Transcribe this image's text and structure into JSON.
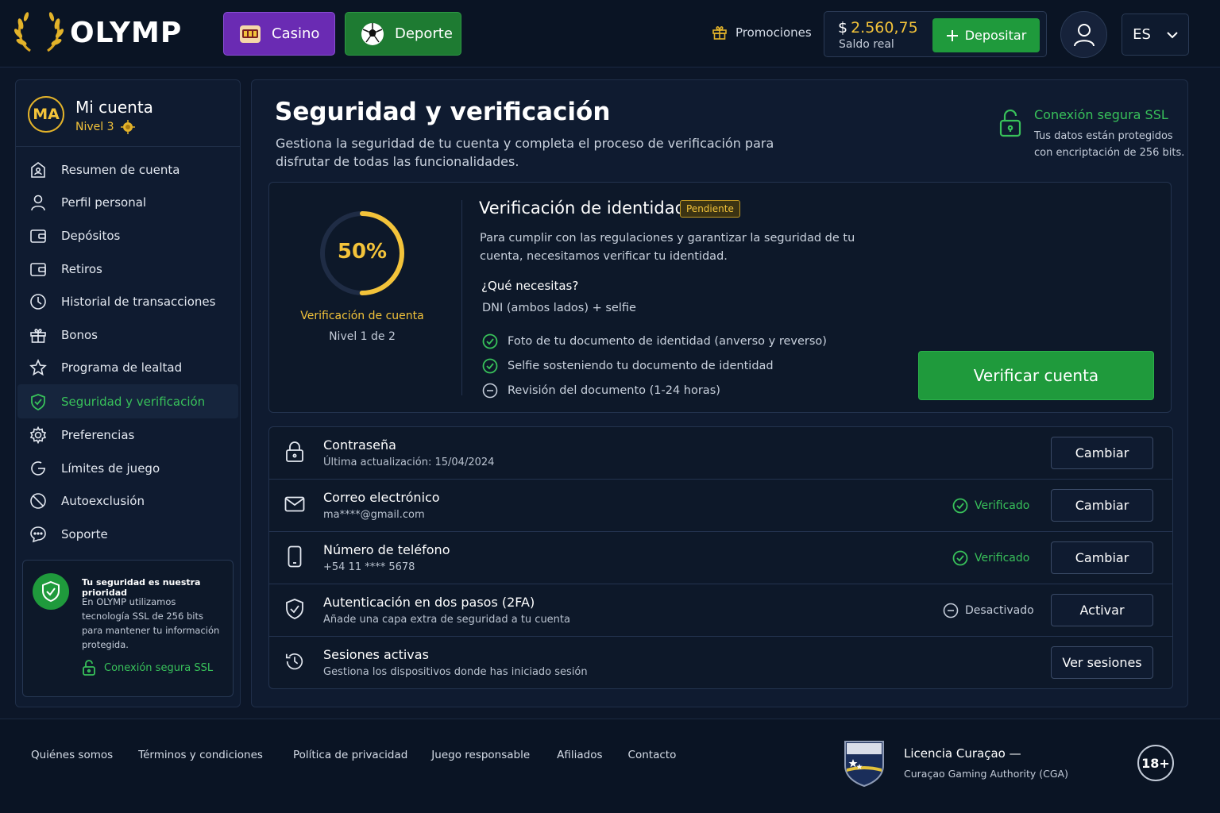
{
  "header": {
    "logo_text": "OLYMP",
    "nav": {
      "casino": "Casino",
      "deporte": "Deporte"
    },
    "promotions": "Promociones",
    "balance": {
      "currency": "$",
      "amount": "2.560,75",
      "label": "Saldo real"
    },
    "deposit": "Depositar",
    "language": "ES"
  },
  "sidebar": {
    "avatar_initials": "MA",
    "title": "Mi cuenta",
    "level": "Nivel 3",
    "items": [
      {
        "label": "Resumen de cuenta",
        "icon": "account-summary-icon"
      },
      {
        "label": "Perfil personal",
        "icon": "user-icon"
      },
      {
        "label": "Depósitos",
        "icon": "wallet-icon"
      },
      {
        "label": "Retiros",
        "icon": "wallet-icon"
      },
      {
        "label": "Historial de transacciones",
        "icon": "clock-icon"
      },
      {
        "label": "Bonos",
        "icon": "gift-icon"
      },
      {
        "label": "Programa de lealtad",
        "icon": "star-icon"
      },
      {
        "label": "Seguridad y verificación",
        "icon": "shield-check-icon",
        "active": true
      },
      {
        "label": "Preferencias",
        "icon": "gear-icon"
      },
      {
        "label": "Límites de juego",
        "icon": "limit-icon"
      },
      {
        "label": "Autoexclusión",
        "icon": "block-icon"
      },
      {
        "label": "Soporte",
        "icon": "chat-icon"
      }
    ],
    "security_card": {
      "title": "Tu seguridad es nuestra prioridad",
      "text": "En OLYMP utilizamos tecnología SSL de 256 bits para mantener tu información protegida.",
      "ssl": "Conexión segura SSL"
    }
  },
  "main": {
    "title": "Seguridad y verificación",
    "subtitle": "Gestiona la seguridad de tu cuenta y completa el proceso de verificación para disfrutar de todas las funcionalidades.",
    "ssl": {
      "title": "Conexión segura SSL",
      "text": "Tus datos están protegidos con encriptación de 256 bits."
    },
    "verification": {
      "progress_value": 0.5,
      "percent_label": "50%",
      "label": "Verificación de cuenta",
      "level": "Nivel 1 de 2",
      "title": "Verificación de identidad",
      "badge": "Pendiente",
      "description": "Para cumplir con las regulaciones y garantizar la seguridad de tu cuenta, necesitamos verificar tu identidad.",
      "question": "¿Qué necesitas?",
      "requirement": "DNI (ambos lados) + selfie",
      "checklist": [
        {
          "text": "Foto de tu documento de identidad (anverso y reverso)",
          "done": true
        },
        {
          "text": "Selfie sosteniendo tu documento de identidad",
          "done": true
        },
        {
          "text": "Revisión del documento (1-24 horas)",
          "done": false
        }
      ],
      "button": "Verificar cuenta"
    },
    "settings": [
      {
        "title": "Contraseña",
        "sub": "Última actualización: 15/04/2024",
        "status": "",
        "button": "Cambiar"
      },
      {
        "title": "Correo electrónico",
        "sub": "ma****@gmail.com",
        "status": "Verificado",
        "button": "Cambiar"
      },
      {
        "title": "Número de teléfono",
        "sub": "+54 11 **** 5678",
        "status": "Verificado",
        "button": "Cambiar"
      },
      {
        "title": "Autenticación en dos pasos (2FA)",
        "sub": "Añade una capa extra de seguridad a tu cuenta",
        "status": "Desactivado",
        "button": "Activar"
      },
      {
        "title": "Sesiones activas",
        "sub": "Gestiona los dispositivos donde has iniciado sesión",
        "status": "",
        "button": "Ver sesiones"
      }
    ]
  },
  "footer": {
    "links": [
      "Quiénes somos",
      "Términos y condiciones",
      "Política de privacidad",
      "Juego responsable",
      "Afiliados",
      "Contacto"
    ],
    "license_title": "Licencia Curaçao —",
    "license_sub": "Curaçao Gaming Authority (CGA)",
    "age": "18+"
  },
  "colors": {
    "accent_green": "#1f9a3c",
    "accent_gold": "#f3c33a",
    "casino_purple": "#6a2bb3",
    "background": "#0c1628"
  }
}
